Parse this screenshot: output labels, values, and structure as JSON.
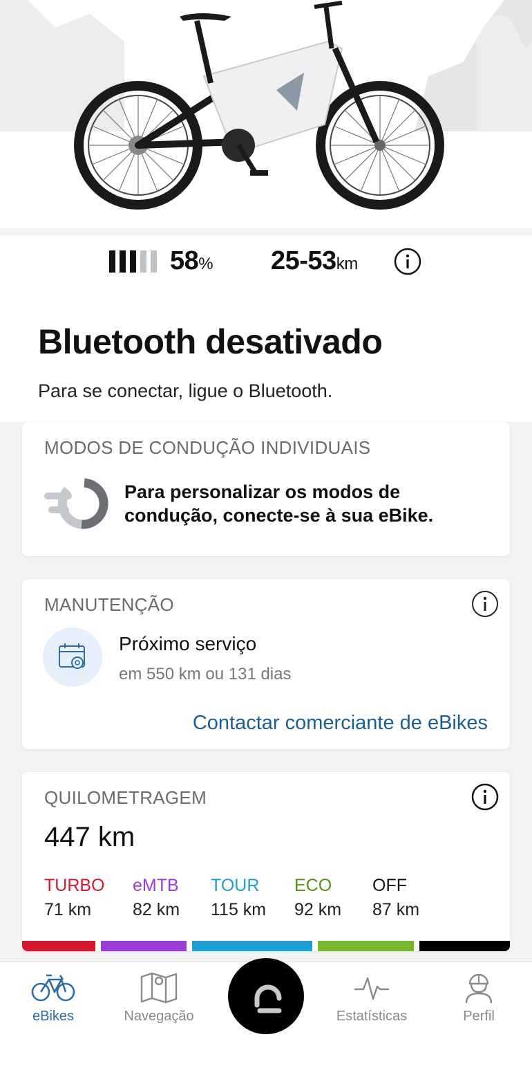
{
  "bike": {
    "battery_value": "58",
    "battery_unit": "%",
    "battery_level_fraction": 0.58,
    "range_value": "25-53",
    "range_unit": "km",
    "range_info_icon": "info-icon"
  },
  "status": {
    "title": "Bluetooth desativado",
    "subtitle": "Para se conectar, ligue o Bluetooth."
  },
  "riding_modes": {
    "title": "MODOS DE CONDUÇÃO INDIVIDUAIS",
    "icon": "riding-mode-dial-icon",
    "message": "Para personalizar os modos de condução, conecte-se à sua eBike."
  },
  "maintenance": {
    "title": "MANUTENÇÃO",
    "info_icon": "info-icon",
    "icon": "calendar-gear-icon",
    "label": "Próximo serviço",
    "detail": "em 550 km ou 131 dias",
    "link": "Contactar comerciante de eBikes"
  },
  "mileage": {
    "title": "QUILOMETRAGEM",
    "info_icon": "info-icon",
    "total": "447 km",
    "modes": [
      {
        "name": "TURBO",
        "km": "71 km",
        "color": "#d7172e"
      },
      {
        "name": "eMTB",
        "km": "82 km",
        "color": "#9a3ed6"
      },
      {
        "name": "TOUR",
        "km": "115 km",
        "color": "#1c9fd4"
      },
      {
        "name": "ECO",
        "km": "92 km",
        "color": "#79b82b"
      },
      {
        "name": "OFF",
        "km": "87 km",
        "color": "#000000"
      }
    ]
  },
  "tabbar": {
    "tabs": [
      {
        "label": "eBikes",
        "icon": "bike-icon",
        "active": true
      },
      {
        "label": "Navegação",
        "icon": "map-icon",
        "active": false
      },
      {
        "label": "Estatísticas",
        "icon": "activity-icon",
        "active": false
      },
      {
        "label": "Perfil",
        "icon": "profile-icon",
        "active": false
      }
    ],
    "center_icon": "ride-screen-icon"
  },
  "colors": {
    "accent": "#2e6da4",
    "link": "#1c5e8c",
    "muted_text": "#6b6b6b"
  }
}
